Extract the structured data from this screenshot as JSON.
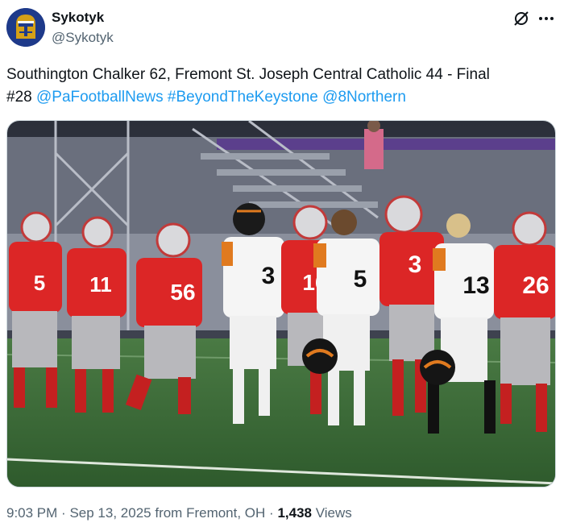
{
  "author": {
    "display_name": "Sykotyk",
    "handle": "@Sykotyk",
    "avatar_icon": "helmeted-knight-avatar"
  },
  "header_icons": [
    "grok-icon",
    "more-options-icon"
  ],
  "tweet": {
    "text_line1": "Southington Chalker 62, Fremont St. Joseph Central Catholic 44 - Final",
    "text_prefix": "#28",
    "hashtags": [
      "@PaFootballNews",
      "#BeyondTheKeystone",
      "@8Northern"
    ]
  },
  "media": {
    "jersey_numbers": [
      "5",
      "11",
      "56",
      "3",
      "16",
      "5",
      "3",
      "13",
      "26"
    ]
  },
  "meta": {
    "time": "9:03 PM",
    "separator": "·",
    "date": "Sep 13, 2025",
    "location": "from Fremont, OH",
    "views_count": "1,438",
    "views_label": "Views"
  },
  "colors": {
    "link": "#1d9bf0",
    "secondary_text": "#536471",
    "home_jersey": "#dc2626",
    "away_jersey": "#f5f5f5",
    "field": "#3d6b3a"
  }
}
